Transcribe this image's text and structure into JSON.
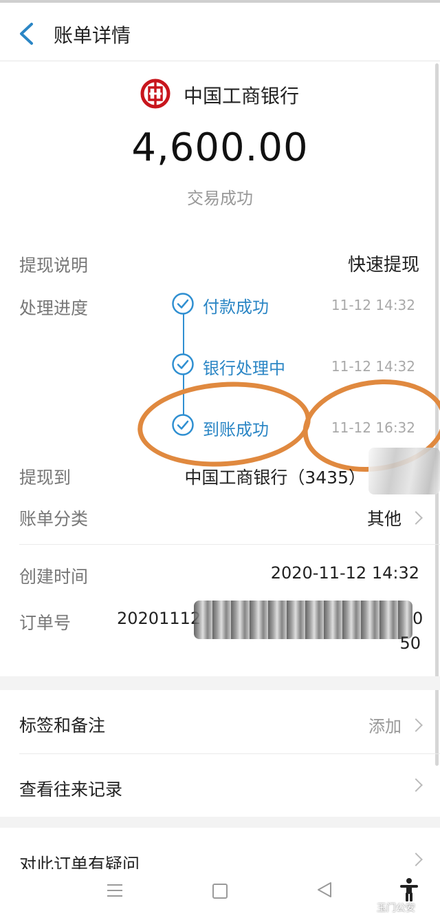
{
  "header": {
    "title": "账单详情"
  },
  "bank": {
    "name": "中国工商银行"
  },
  "amount": "4,600.00",
  "status": "交易成功",
  "details": {
    "withdraw_desc_label": "提现说明",
    "withdraw_desc_value": "快速提现",
    "progress_label": "处理进度",
    "steps": [
      {
        "label": "付款成功",
        "time": "11-12 14:32"
      },
      {
        "label": "银行处理中",
        "time": "11-12 14:32"
      },
      {
        "label": "到账成功",
        "time": "11-12 16:32"
      }
    ],
    "withdraw_to_label": "提现到",
    "withdraw_to_value": "中国工商银行（3435）",
    "category_label": "账单分类",
    "category_value": "其他",
    "created_label": "创建时间",
    "created_value": "2020-11-12 14:32",
    "order_label": "订单号",
    "order_value_prefix": "20201112",
    "order_value_tail": "0",
    "order_value_line2": "50"
  },
  "actions": {
    "tags_label": "标签和备注",
    "tags_action": "添加",
    "history_label": "查看往来记录",
    "dispute_label": "对此订单有疑问"
  },
  "watermark": "玉门公安",
  "colors": {
    "accent": "#2b86c5",
    "bank_red": "#c8161d",
    "annotation": "#e0893f"
  }
}
